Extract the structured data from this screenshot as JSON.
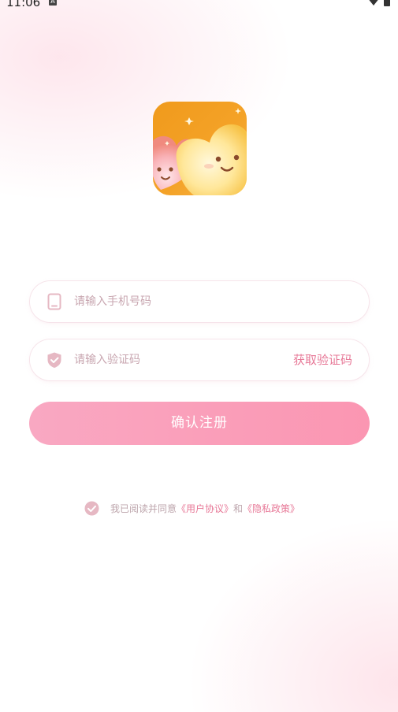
{
  "status_bar": {
    "time": "11:06",
    "notification_icon": "a-icon",
    "wifi_icon": "wifi-icon",
    "battery_icon": "battery-icon"
  },
  "app": {
    "logo_icon": "heart-faces-logo"
  },
  "phone_field": {
    "placeholder": "请输入手机号码",
    "value": "",
    "icon": "phone-icon"
  },
  "code_field": {
    "placeholder": "请输入验证码",
    "value": "",
    "icon": "shield-icon",
    "get_code_label": "获取验证码"
  },
  "submit": {
    "label": "确认注册"
  },
  "agreement": {
    "prefix": "我已阅读并同意",
    "user_agreement": "《用户协议》",
    "conjunction": "和",
    "privacy_policy": "《隐私政策》",
    "checked": true
  },
  "colors": {
    "accent": "#e77897",
    "button_start": "#f9a8c2",
    "button_end": "#fb96b2",
    "placeholder": "#c8a6b0",
    "icon": "#e6b8c3"
  }
}
